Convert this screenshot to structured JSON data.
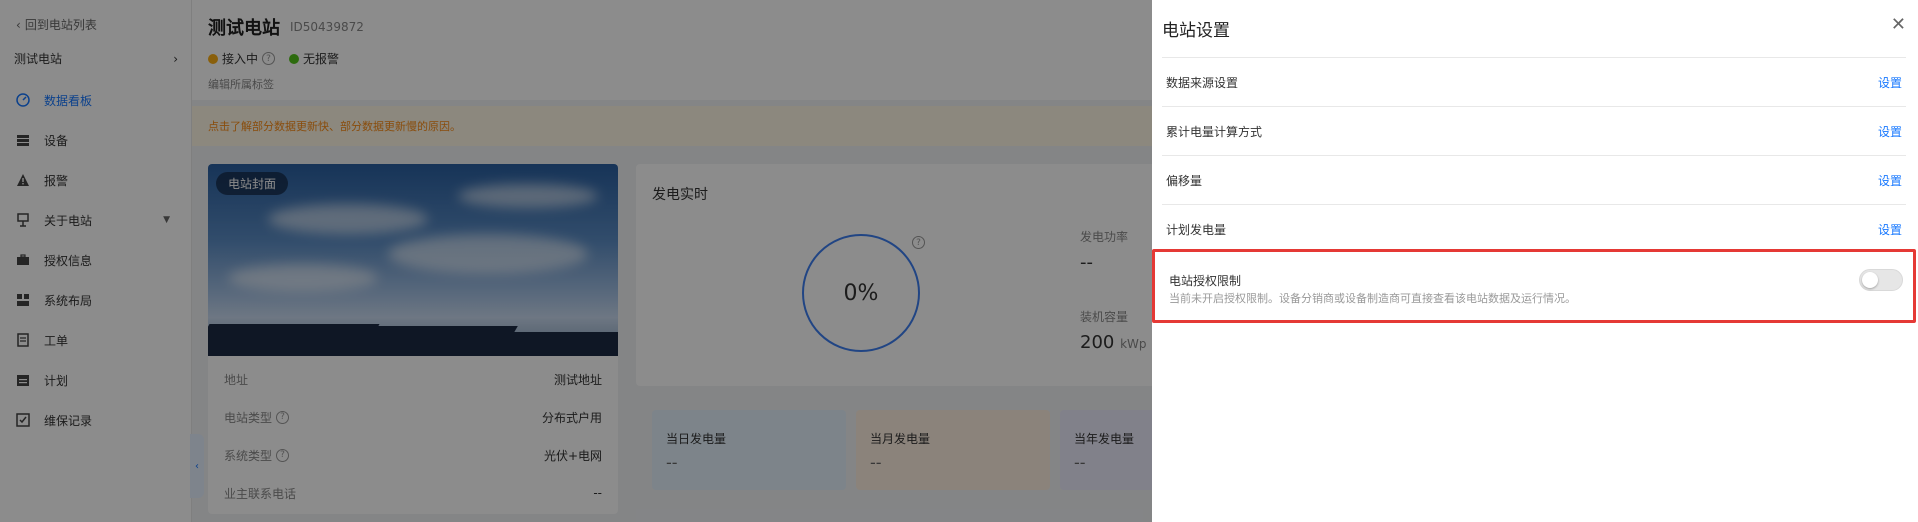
{
  "sidebar": {
    "back_label": "回到电站列表",
    "station_name": "测试电站",
    "items": [
      {
        "label": "数据看板",
        "icon": "dashboard-icon"
      },
      {
        "label": "设备",
        "icon": "device-icon"
      },
      {
        "label": "报警",
        "icon": "alarm-icon"
      },
      {
        "label": "关于电站",
        "icon": "station-icon"
      },
      {
        "label": "授权信息",
        "icon": "briefcase-icon"
      },
      {
        "label": "系统布局",
        "icon": "layout-icon"
      },
      {
        "label": "工单",
        "icon": "workorder-icon"
      },
      {
        "label": "计划",
        "icon": "calendar-icon"
      },
      {
        "label": "维保记录",
        "icon": "maintenance-icon"
      }
    ]
  },
  "header": {
    "title": "测试电站",
    "station_id": "ID50439872",
    "status_connecting": "接入中",
    "status_alarm": "无报警",
    "edit_tags": "编辑所属标签"
  },
  "notice": "点击了解部分数据更新快、部分数据更新慢的原因。",
  "cover": {
    "tag": "电站封面"
  },
  "info": [
    {
      "label": "地址",
      "value": "测试地址"
    },
    {
      "label": "电站类型",
      "value": "分布式户用"
    },
    {
      "label": "系统类型",
      "value": "光伏+电网"
    },
    {
      "label": "业主联系电话",
      "value": "--"
    }
  ],
  "realtime": {
    "title": "发电实时",
    "percent": "0%",
    "power_label": "发电功率",
    "power_value": "--",
    "capacity_label": "装机容量",
    "capacity_value": "200",
    "capacity_unit": "kWp"
  },
  "stats": [
    {
      "label": "当日发电量",
      "value": "--"
    },
    {
      "label": "当月发电量",
      "value": "--"
    },
    {
      "label": "当年发电量",
      "value": "--"
    }
  ],
  "drawer": {
    "title": "电站设置",
    "rows": [
      {
        "label": "数据来源设置",
        "action": "设置"
      },
      {
        "label": "累计电量计算方式",
        "action": "设置"
      },
      {
        "label": "偏移量",
        "action": "设置"
      },
      {
        "label": "计划发电量",
        "action": "设置"
      }
    ],
    "auth_title": "电站授权限制",
    "auth_desc": "当前未开启授权限制。设备分销商或设备制造商可直接查看该电站数据及运行情况。",
    "auth_enabled": false
  },
  "colors": {
    "accent": "#1677ff",
    "highlight": "#e53935",
    "warning": "#fa8c16"
  }
}
